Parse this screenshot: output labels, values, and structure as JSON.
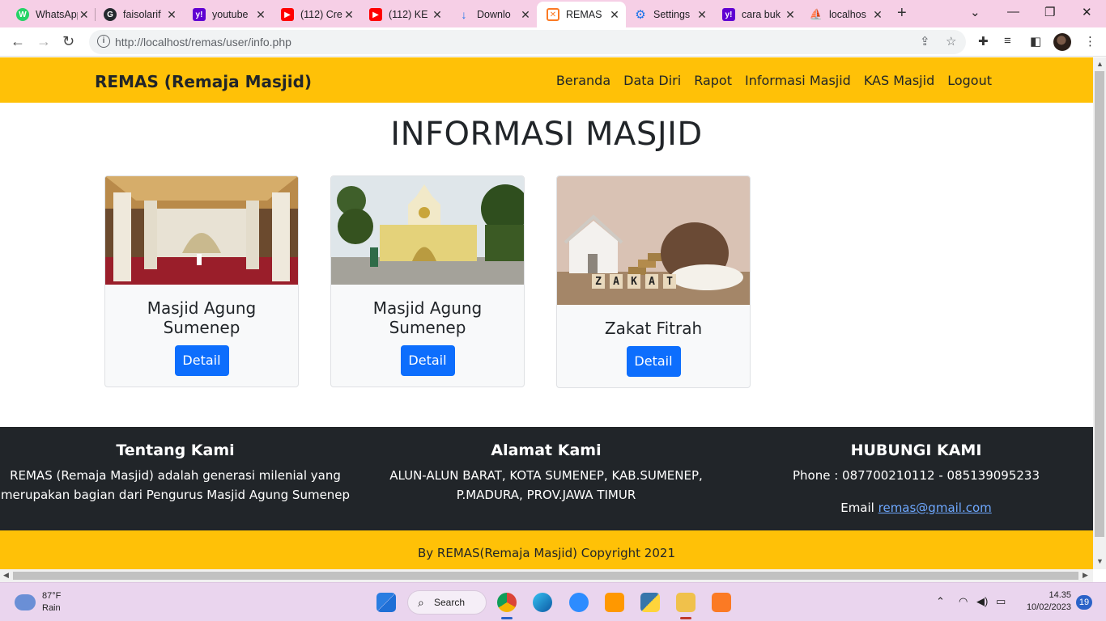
{
  "browser": {
    "tabs": [
      {
        "label": "WhatsApp",
        "icon": "whatsapp-icon",
        "color": "#25d366",
        "glyph": "W"
      },
      {
        "label": "faisolarif",
        "icon": "github-icon",
        "color": "#24292e",
        "glyph": "G"
      },
      {
        "label": "youtube",
        "icon": "yahoo-icon",
        "color": "#6001d2",
        "glyph": "y!"
      },
      {
        "label": "(112) Cre",
        "icon": "youtube-icon",
        "color": "#ff0000",
        "glyph": "▶"
      },
      {
        "label": "(112) KE",
        "icon": "youtube-icon",
        "color": "#ff0000",
        "glyph": "▶"
      },
      {
        "label": "Downlo",
        "icon": "download-icon",
        "color": "#1a73e8",
        "glyph": "↓"
      },
      {
        "label": "REMAS",
        "icon": "xampp-icon",
        "color": "#fb7a24",
        "glyph": "✕"
      },
      {
        "label": "Settings",
        "icon": "settings-icon",
        "color": "#1a73e8",
        "glyph": "⚙"
      },
      {
        "label": "cara buk",
        "icon": "yahoo-icon",
        "color": "#6001d2",
        "glyph": "y!"
      },
      {
        "label": "localhos",
        "icon": "phpmyadmin-icon",
        "color": "#f29111",
        "glyph": "⛵"
      }
    ],
    "url": "http://localhost/remas/user/info.php"
  },
  "site": {
    "brand": "REMAS (Remaja Masjid)",
    "nav": [
      "Beranda",
      "Data Diri",
      "Rapot",
      "Informasi Masjid",
      "KAS Masjid",
      "Logout"
    ],
    "page_title": "INFORMASI MASJID",
    "cards": [
      {
        "title": "Masjid Agung Sumenep",
        "button": "Detail"
      },
      {
        "title": "Masjid Agung Sumenep",
        "button": "Detail"
      },
      {
        "title": "Zakat Fitrah",
        "button": "Detail"
      }
    ],
    "zakat_letters": [
      "Z",
      "A",
      "K",
      "A",
      "T"
    ],
    "footer": {
      "about_title": "Tentang Kami",
      "about_text_1": "REMAS (Remaja Masjid) adalah generasi milenial yang",
      "about_text_2": "merupakan bagian dari Pengurus Masjid Agung Sumenep",
      "address_title": "Alamat Kami",
      "address_1": "ALUN-ALUN BARAT, KOTA SUMENEP, KAB.SUMENEP,",
      "address_2": "P.MADURA, PROV.JAWA TIMUR",
      "contact_title": "HUBUNGI KAMI",
      "phone": "Phone : 087700210112 - 085139095233",
      "email_label": "Email",
      "email": "remas@gmail.com"
    },
    "copyright": "By REMAS(Remaja Masjid) Copyright 2021"
  },
  "taskbar": {
    "temp": "87°F",
    "condition": "Rain",
    "search": "Search",
    "time": "14.35",
    "date": "10/02/2023",
    "notifications": "19"
  },
  "colors": {
    "navbar": "#ffc107",
    "primary_button": "#0d6efd",
    "footer": "#212529"
  }
}
